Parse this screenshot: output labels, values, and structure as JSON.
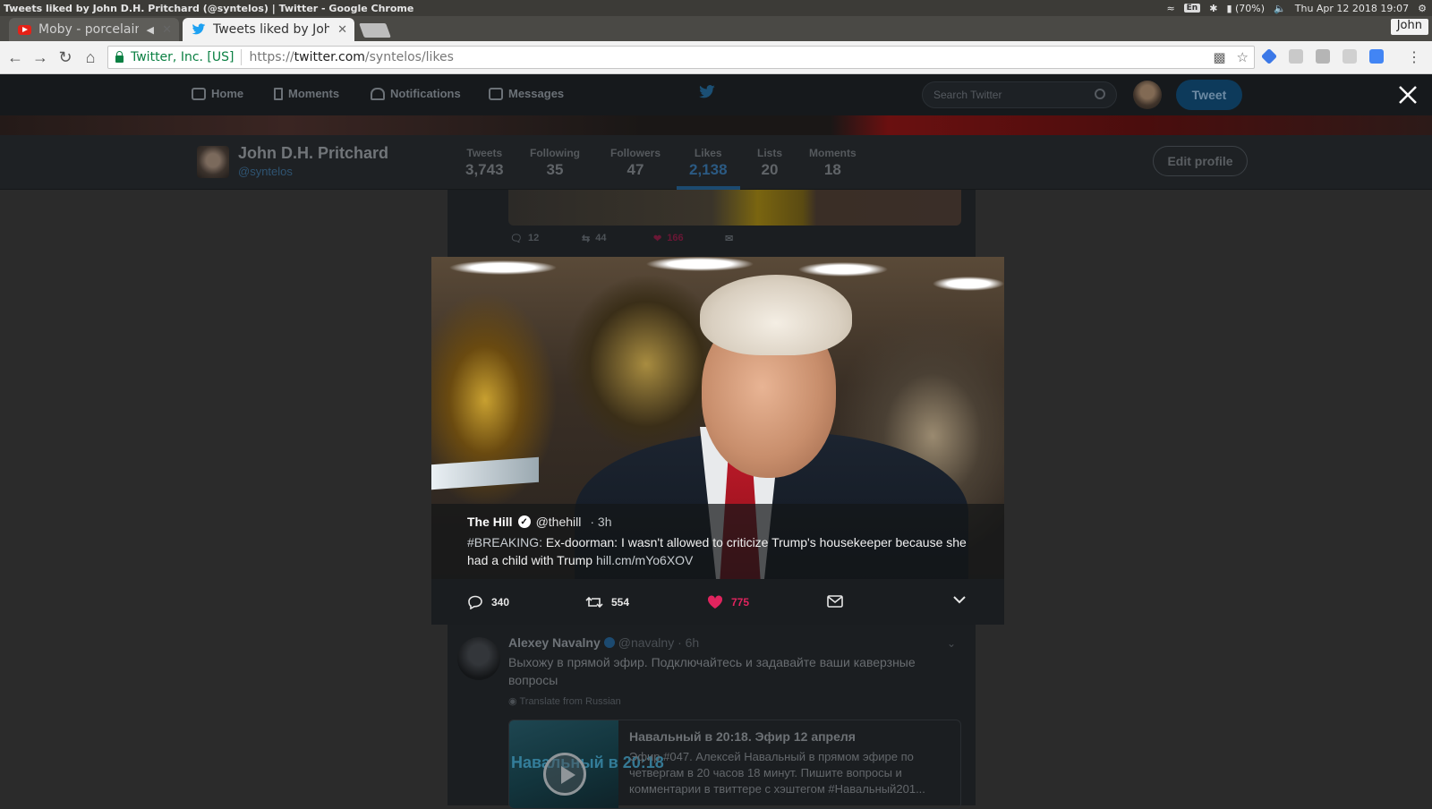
{
  "system_bar": {
    "window_title": "Tweets liked by John D.H. Pritchard (@syntelos) | Twitter - Google Chrome",
    "keyboard": "En",
    "battery": "(70%)",
    "clock": "Thu Apr 12 2018 19:07"
  },
  "browser": {
    "tabs": [
      {
        "label": "Moby - porcelain",
        "icon": "youtube-icon"
      },
      {
        "label": "Tweets liked by John D.H. Pritchard (@syntelos)",
        "icon": "twitter-bird-icon"
      }
    ],
    "user": "John",
    "security_label": "Twitter, Inc. [US]",
    "url_protocol": "https://",
    "url_host": "twitter.com",
    "url_path": "/syntelos/likes"
  },
  "twitter_nav": {
    "items": [
      "Home",
      "Moments",
      "Notifications",
      "Messages"
    ],
    "search_placeholder": "Search Twitter",
    "tweet_button": "Tweet"
  },
  "profile": {
    "name": "John D.H. Pritchard",
    "handle": "@syntelos",
    "stats": [
      {
        "label": "Tweets",
        "value": "3,743"
      },
      {
        "label": "Following",
        "value": "35"
      },
      {
        "label": "Followers",
        "value": "47"
      },
      {
        "label": "Likes",
        "value": "2,138",
        "active": true
      },
      {
        "label": "Lists",
        "value": "20"
      },
      {
        "label": "Moments",
        "value": "18"
      }
    ],
    "edit_button": "Edit profile"
  },
  "previous_tweet_actions": {
    "replies": "12",
    "retweets": "44",
    "likes": "166"
  },
  "modal_tweet": {
    "author": "The Hill",
    "handle": "@thehill",
    "time": "· 3h",
    "hashtag": "#BREAKING:",
    "text": " Ex-doorman: I wasn't allowed to criticize Trump's housekeeper because she had a child with Trump ",
    "link": "hill.cm/mYo6XOV",
    "replies": "340",
    "retweets": "554",
    "likes": "775",
    "accent_like": "#e0245e"
  },
  "next_tweet": {
    "author": "Alexey Navalny",
    "handle": "@navalny",
    "time": "· 6h",
    "text": "Выхожу в прямой эфир. Подключайтесь и задавайте ваши каверзные вопросы",
    "translate": "Translate from Russian",
    "card_thumb_text": "Навальный в 20:18",
    "card_title": "Навальный в 20:18. Эфир 12 апреля",
    "card_desc": "Эфир #047. Алексей Навальный в прямом эфире по четвергам в 20 часов 18 минут. Пишите вопросы и комментарии в твиттере с хэштегом #Навальный201..."
  }
}
